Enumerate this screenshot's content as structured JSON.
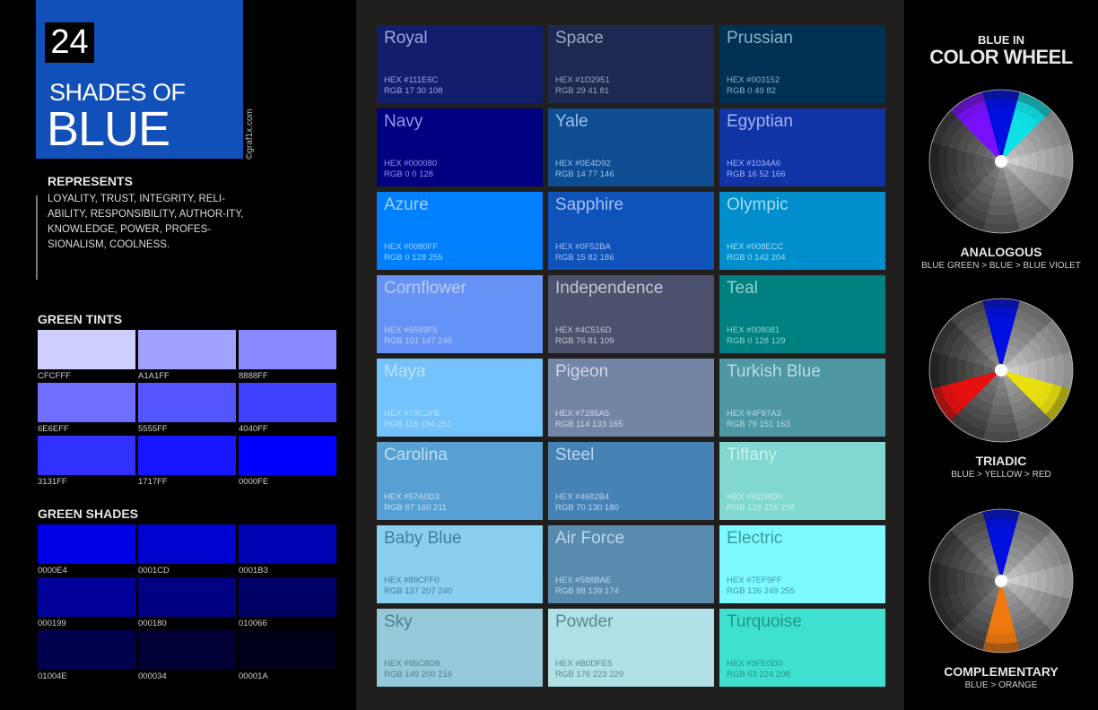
{
  "hero": {
    "count": "24",
    "subtitle": "SHADES OF",
    "title": "BLUE",
    "credit": "©graf1x.com",
    "color": "#1150B8"
  },
  "represents": {
    "title": "REPRESENTS",
    "text": "LOYALITY, TRUST, INTEGRITY, RELI-ABILITY, RESPONSIBILITY, AUTHOR-ITY, KNOWLEDGE, POWER, PROFES-SIONALISM, COOLNESS."
  },
  "tints": {
    "title": "GREEN TINTS",
    "items": [
      {
        "label": "CFCFFF",
        "color": "#CFCFFF"
      },
      {
        "label": "A1A1FF",
        "color": "#A1A1FF"
      },
      {
        "label": "8888FF",
        "color": "#8888FF"
      },
      {
        "label": "6E6EFF",
        "color": "#6E6EFF"
      },
      {
        "label": "5555FF",
        "color": "#5555FF"
      },
      {
        "label": "4040FF",
        "color": "#4040FF"
      },
      {
        "label": "3131FF",
        "color": "#3131FF"
      },
      {
        "label": "1717FF",
        "color": "#1717FF"
      },
      {
        "label": "0000FE",
        "color": "#0000FE"
      }
    ]
  },
  "shades": {
    "title": "GREEN SHADES",
    "items": [
      {
        "label": "0000E4",
        "color": "#0000E4"
      },
      {
        "label": "0001CD",
        "color": "#0001CD"
      },
      {
        "label": "0001B3",
        "color": "#0001B3"
      },
      {
        "label": "000199",
        "color": "#000199"
      },
      {
        "label": "000180",
        "color": "#000180"
      },
      {
        "label": "010066",
        "color": "#010066"
      },
      {
        "label": "01004E",
        "color": "#01004E"
      },
      {
        "label": "000034",
        "color": "#000034"
      },
      {
        "label": "00001A",
        "color": "#00001A"
      }
    ]
  },
  "cards": [
    {
      "name": "Royal",
      "hex": "HEX #111E6C",
      "rgb": "RGB 17 30 108",
      "color": "#111E6C",
      "text_color": "#9aa6e0"
    },
    {
      "name": "Space",
      "hex": "HEX #1D2951",
      "rgb": "RGB 29 41 81",
      "color": "#1D2951",
      "text_color": "#9aa6c8"
    },
    {
      "name": "Prussian",
      "hex": "HEX #003152",
      "rgb": "RGB 0 49 82",
      "color": "#003152",
      "text_color": "#8fb0c8"
    },
    {
      "name": "Navy",
      "hex": "HEX #000080",
      "rgb": "RGB 0 0 128",
      "color": "#000080",
      "text_color": "#8f9ae6"
    },
    {
      "name": "Yale",
      "hex": "HEX #0E4D92",
      "rgb": "RGB 14 77 146",
      "color": "#0E4D92",
      "text_color": "#9fc0ea"
    },
    {
      "name": "Egyptian",
      "hex": "HEX #1034A6",
      "rgb": "RGB 16 52 166",
      "color": "#1034A6",
      "text_color": "#a3b4f0"
    },
    {
      "name": "Azure",
      "hex": "HEX #0080FF",
      "rgb": "RGB 0 128 255",
      "color": "#0080FF",
      "text_color": "#9fd0ff"
    },
    {
      "name": "Sapphire",
      "hex": "HEX #0F52BA",
      "rgb": "RGB 15 82 186",
      "color": "#0F52BA",
      "text_color": "#a3c0f0"
    },
    {
      "name": "Olympic",
      "hex": "HEX #008ECC",
      "rgb": "RGB 0 142 204",
      "color": "#008ECC",
      "text_color": "#a3dcf5"
    },
    {
      "name": "Cornflower",
      "hex": "HEX #6593F5",
      "rgb": "RGB 101 147 245",
      "color": "#6593F5",
      "text_color": "#b8ccf9"
    },
    {
      "name": "Independence",
      "hex": "HEX #4C516D",
      "rgb": "RGB 76 81 109",
      "color": "#4C516D",
      "text_color": "#c3c6d6"
    },
    {
      "name": "Teal",
      "hex": "HEX #008081",
      "rgb": "RGB 0 128 129",
      "color": "#008081",
      "text_color": "#8fd3d0"
    },
    {
      "name": "Maya",
      "hex": "HEX #73C2FB",
      "rgb": "RGB 115 194 251",
      "color": "#73C2FB",
      "text_color": "#b9e1fd"
    },
    {
      "name": "Pigeon",
      "hex": "HEX #7285A5",
      "rgb": "RGB 114 133 165",
      "color": "#7285A5",
      "text_color": "#cfd7e5"
    },
    {
      "name": "Turkish Blue",
      "hex": "HEX #4F97A3",
      "rgb": "RGB 79 151 163",
      "color": "#4F97A3",
      "text_color": "#b8dde2"
    },
    {
      "name": "Carolina",
      "hex": "HEX #57A0D3",
      "rgb": "RGB 87 160 211",
      "color": "#57A0D3",
      "text_color": "#c2def2"
    },
    {
      "name": "Steel",
      "hex": "HEX #4682B4",
      "rgb": "RGB 70 130 180",
      "color": "#4682B4",
      "text_color": "#bcd6ee"
    },
    {
      "name": "Tiffany",
      "hex": "HEX #81D8D0",
      "rgb": "RGB 129 216 208",
      "color": "#81D8D0",
      "text_color": "#c8f2ee"
    },
    {
      "name": "Baby Blue",
      "hex": "HEX #89CFF0",
      "rgb": "RGB 137 207 240",
      "color": "#89CFF0",
      "text_color": "#3f7f9c"
    },
    {
      "name": "Air Force",
      "hex": "HEX #588BAE",
      "rgb": "RGB 88 139 174",
      "color": "#588BAE",
      "text_color": "#bcd8ec"
    },
    {
      "name": "Electric",
      "hex": "HEX #7EF9FF",
      "rgb": "RGB 126 249 255",
      "color": "#7EF9FF",
      "text_color": "#3a9aa0"
    },
    {
      "name": "Sky",
      "hex": "HEX #95C8D8",
      "rgb": "RGB 149 200 216",
      "color": "#95C8D8",
      "text_color": "#4e7f8e"
    },
    {
      "name": "Powder",
      "hex": "HEX #B0DFE5",
      "rgb": "RGB 176 223 229",
      "color": "#B0DFE5",
      "text_color": "#5a8a92"
    },
    {
      "name": "Turquoise",
      "hex": "HEX #3FE0D0",
      "rgb": "RGB 63 224 208",
      "color": "#3FE0D0",
      "text_color": "#23958a"
    }
  ],
  "color_wheel": {
    "title_line1": "BLUE IN",
    "title_line2": "COLOR WHEEL",
    "schemes": [
      {
        "name": "ANALOGOUS",
        "description": "BLUE GREEN > BLUE > BLUE VIOLET",
        "highlights": [
          {
            "segment": 11,
            "color": "#7a10ff"
          },
          {
            "segment": 0,
            "color": "#0010e0"
          },
          {
            "segment": 1,
            "color": "#10e0e8"
          }
        ]
      },
      {
        "name": "TRIADIC",
        "description": "BLUE > YELLOW > RED",
        "highlights": [
          {
            "segment": 0,
            "color": "#0010e0"
          },
          {
            "segment": 4,
            "color": "#e8e010"
          },
          {
            "segment": 8,
            "color": "#e81010"
          }
        ]
      },
      {
        "name": "COMPLEMENTARY",
        "description": "BLUE > ORANGE",
        "highlights": [
          {
            "segment": 0,
            "color": "#0010e0"
          },
          {
            "segment": 6,
            "color": "#f07a10"
          }
        ]
      }
    ]
  }
}
